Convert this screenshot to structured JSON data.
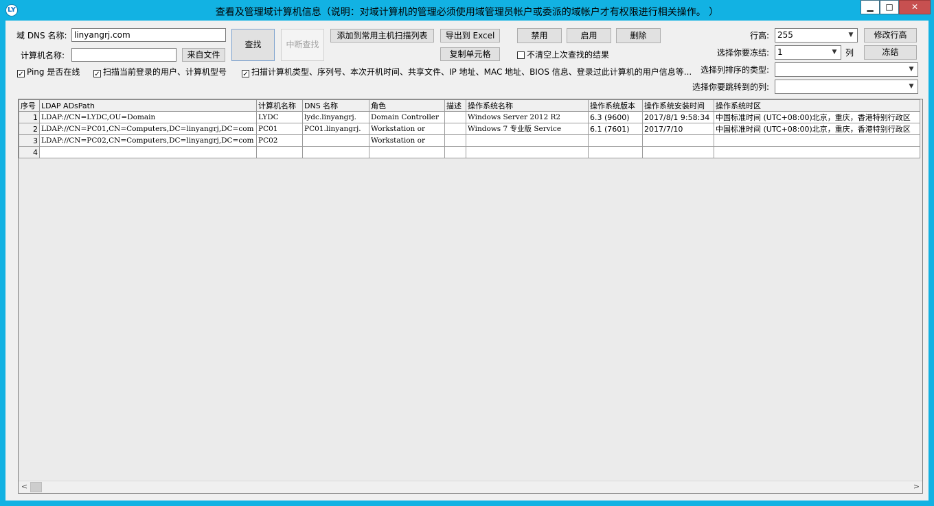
{
  "window": {
    "title": "查看及管理域计算机信息（说明：对域计算机的管理必须使用域管理员帐户或委派的域帐户才有权限进行相关操作。 ）",
    "app_icon": "LY",
    "min_glyph": "▁",
    "max_glyph": "□",
    "close_glyph": "✕"
  },
  "form": {
    "dns_label": "域 DNS 名称:",
    "dns_value": "linyangrj.com",
    "computer_label": "计算机名称:",
    "computer_value": "",
    "from_file": "来自文件",
    "search": "查找",
    "stop_search": "中断查找",
    "add_to_scan_list": "添加到常用主机扫描列表",
    "export_excel": "导出到 Excel",
    "copy_cell": "复制单元格",
    "disable": "禁用",
    "enable": "启用",
    "delete": "删除",
    "keep_results_label": "不清空上次查找的结果",
    "keep_results_checked": false,
    "ping_label": "Ping 是否在线",
    "ping_checked": true,
    "scan_user_label": "扫描当前登录的用户、计算机型号",
    "scan_user_checked": true,
    "scan_type_label": "扫描计算机类型、序列号、本次开机时间、共享文件、IP 地址、MAC 地址、BIOS 信息、登录过此计算机的用户信息等...",
    "scan_type_checked": true,
    "row_height_label": "行高:",
    "row_height_value": "255",
    "modify_row_height": "修改行高",
    "freeze_label": "选择你要冻结:",
    "freeze_value": "1",
    "freeze_unit": "列",
    "freeze_button": "冻结",
    "sort_label": "选择列排序的类型:",
    "sort_value": "",
    "jump_label": "选择你要跳转到的列:",
    "jump_value": ""
  },
  "grid": {
    "columns": [
      "序号",
      "LDAP ADsPath",
      "计算机名称",
      "DNS 名称",
      "角色",
      "描述",
      "操作系统名称",
      "操作系统版本",
      "操作系统安装时间",
      "操作系统时区"
    ],
    "rows": [
      [
        "1",
        "LDAP://CN=LYDC,OU=Domain",
        "LYDC",
        "lydc.linyangrj.",
        "Domain Controller",
        "",
        "Windows Server 2012 R2",
        "6.3 (9600)",
        "2017/8/1 9:58:34",
        "中国标准时间 (UTC+08:00)北京，重庆，香港特别行政区"
      ],
      [
        "2",
        "LDAP://CN=PC01,CN=Computers,DC=linyangrj,DC=com",
        "PC01",
        "PC01.linyangrj.",
        "Workstation or",
        "",
        "Windows 7 专业版 Service",
        "6.1 (7601)",
        "2017/7/10",
        "中国标准时间 (UTC+08:00)北京，重庆，香港特别行政区"
      ],
      [
        "3",
        "LDAP://CN=PC02,CN=Computers,DC=linyangrj,DC=com",
        "PC02",
        "",
        "Workstation or",
        "",
        "",
        "",
        "",
        ""
      ],
      [
        "4",
        "",
        "",
        "",
        "",
        "",
        "",
        "",
        "",
        ""
      ]
    ]
  },
  "scrollbar": {
    "left_arrow": "<",
    "right_arrow": ">"
  }
}
